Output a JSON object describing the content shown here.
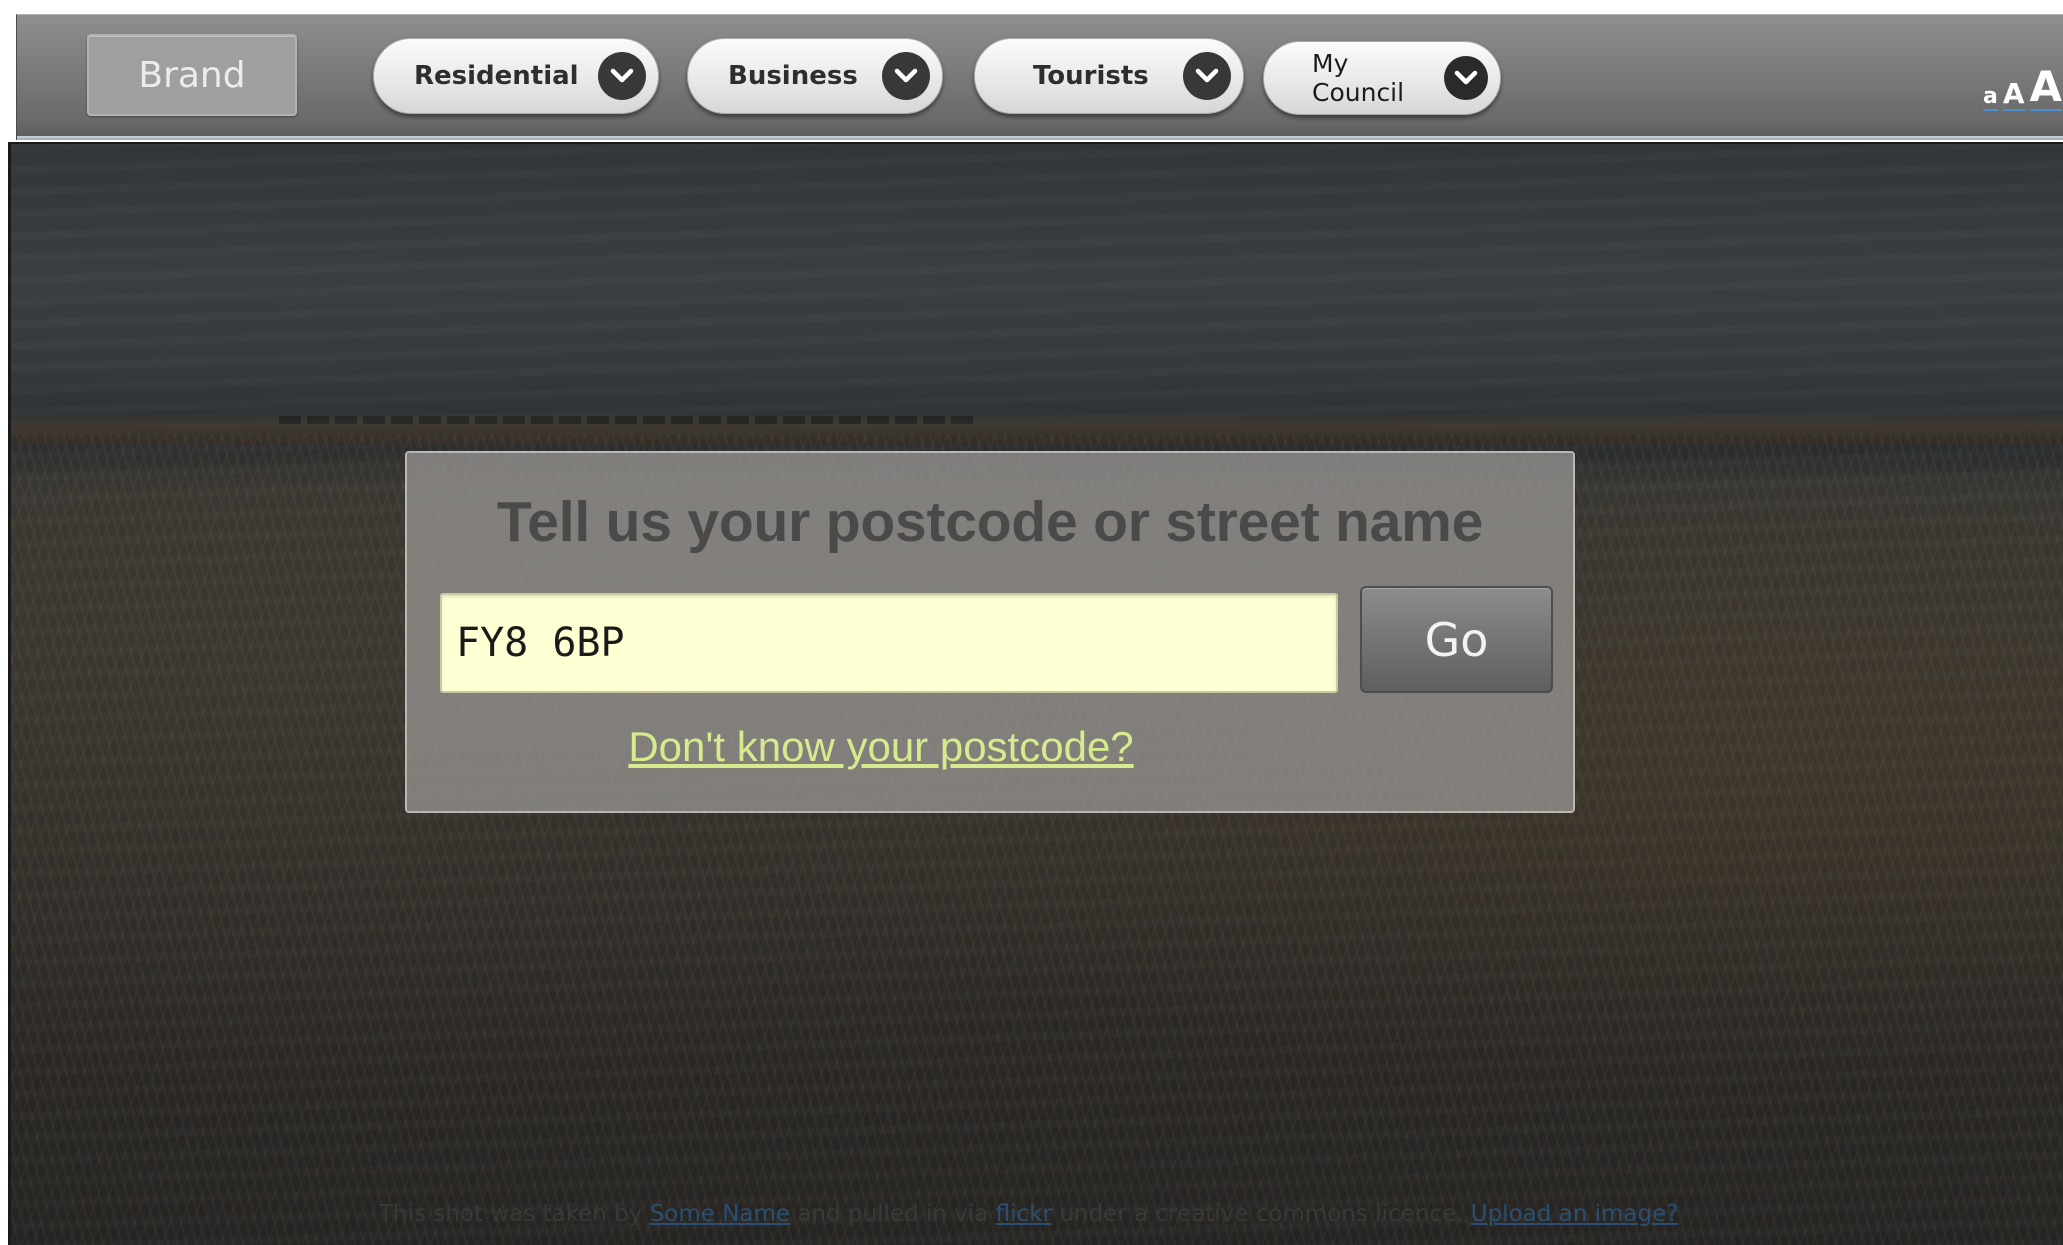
{
  "header": {
    "brand": "Brand",
    "menus": [
      {
        "label": "Residential"
      },
      {
        "label": "Business"
      },
      {
        "label": "Tourists"
      },
      {
        "label": "My Council"
      }
    ],
    "text_size": {
      "small": "a",
      "medium": "A",
      "large": "A"
    }
  },
  "search": {
    "title": "Tell us your postcode or street name",
    "input_value": "FY8 6BP",
    "go_label": "Go",
    "help_link": "Don't know your postcode?"
  },
  "credit": {
    "prefix": "This shot was taken by",
    "photographer": "Some Name",
    "middle": "and pulled in via",
    "source": "flickr",
    "suffix": "under a creative commons licence.",
    "upload_link": "Upload an image?"
  },
  "colors": {
    "input_bg": "#ffffd4",
    "link_green": "#d6eb8d",
    "nav_gray": "#7b7b7b",
    "pill_icon": "#383838"
  },
  "icons": {
    "menu_dropdown": "chevron-down-icon"
  }
}
